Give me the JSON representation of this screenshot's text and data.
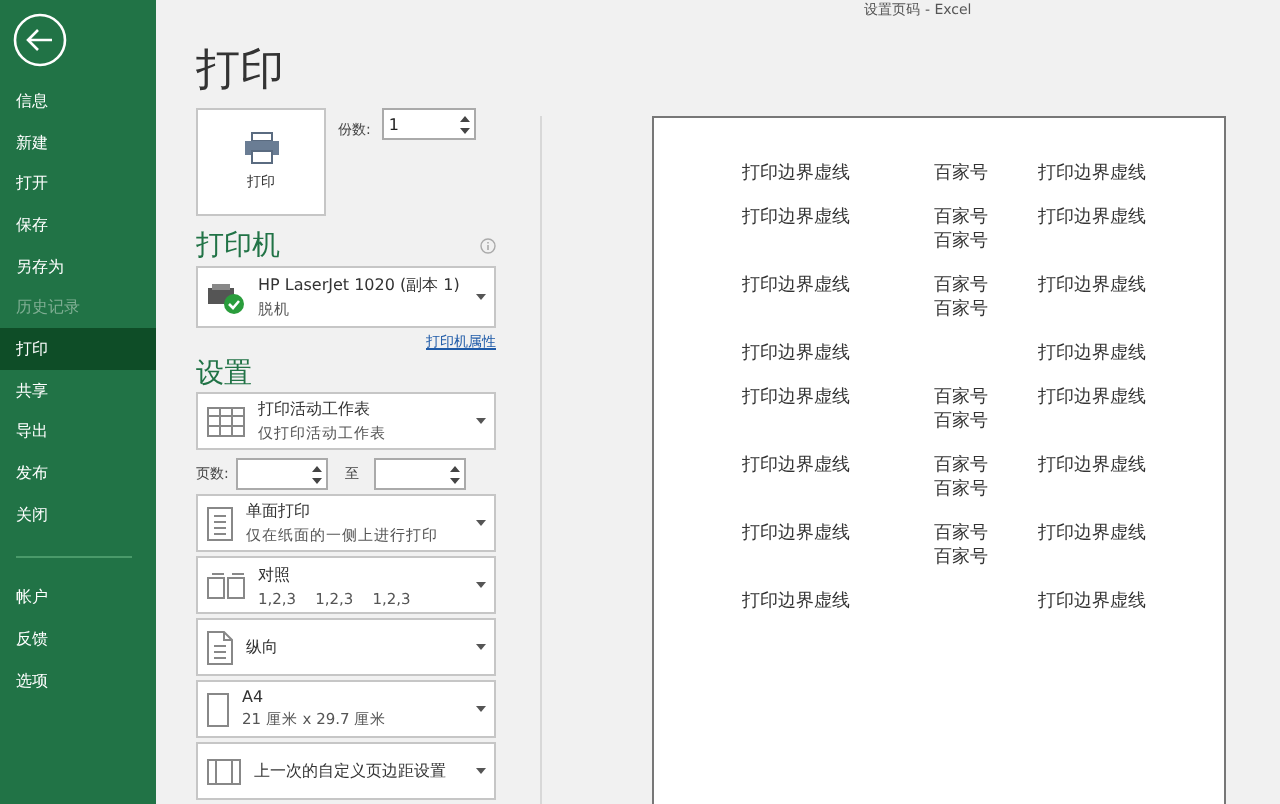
{
  "window": {
    "title": "设置页码 - Excel"
  },
  "sidebar": {
    "items": [
      {
        "label": "信息",
        "selected": false,
        "disabled": false
      },
      {
        "label": "新建",
        "selected": false,
        "disabled": false
      },
      {
        "label": "打开",
        "selected": false,
        "disabled": false
      },
      {
        "label": "保存",
        "selected": false,
        "disabled": false
      },
      {
        "label": "另存为",
        "selected": false,
        "disabled": false
      },
      {
        "label": "历史记录",
        "selected": false,
        "disabled": true
      },
      {
        "label": "打印",
        "selected": true,
        "disabled": false
      },
      {
        "label": "共享",
        "selected": false,
        "disabled": false
      },
      {
        "label": "导出",
        "selected": false,
        "disabled": false
      },
      {
        "label": "发布",
        "selected": false,
        "disabled": false
      },
      {
        "label": "关闭",
        "selected": false,
        "disabled": false
      }
    ],
    "bottom_items": [
      {
        "label": "帐户",
        "selected": false,
        "disabled": false
      },
      {
        "label": "反馈",
        "selected": false,
        "disabled": false
      },
      {
        "label": "选项",
        "selected": false,
        "disabled": false
      }
    ]
  },
  "page_title": "打印",
  "print_button": "打印",
  "copies": {
    "label": "份数:",
    "value": "1"
  },
  "printer": {
    "heading": "打印机",
    "name": "HP LaserJet 1020 (副本 1)",
    "status": "脱机",
    "properties_link": "打印机属性"
  },
  "settings": {
    "heading": "设置",
    "options_before_pages": [
      {
        "kind": "sheet",
        "title": "打印活动工作表",
        "subtitle": "仅打印活动工作表"
      }
    ],
    "pages": {
      "label": "页数:",
      "to": "至"
    },
    "options": [
      {
        "kind": "sides",
        "title": "单面打印",
        "subtitle": "仅在纸面的一侧上进行打印"
      },
      {
        "kind": "collate",
        "title": "对照",
        "subtitle": "1,2,3    1,2,3    1,2,3"
      },
      {
        "kind": "orientation",
        "title": "纵向"
      },
      {
        "kind": "paper",
        "title": "A4",
        "subtitle": "21 厘米 x 29.7 厘米"
      },
      {
        "kind": "margins",
        "title": "上一次的自定义页边距设置"
      }
    ]
  },
  "preview": {
    "rows": [
      {
        "left": "打印边界虚线",
        "middle": [
          "百家号"
        ],
        "right": "打印边界虚线"
      },
      {
        "left": "打印边界虚线",
        "middle": [
          "百家号",
          "百家号"
        ],
        "right": "打印边界虚线"
      },
      {
        "left": "打印边界虚线",
        "middle": [
          "百家号",
          "百家号"
        ],
        "right": "打印边界虚线"
      },
      {
        "left": "打印边界虚线",
        "middle": [],
        "right": "打印边界虚线"
      },
      {
        "left": "打印边界虚线",
        "middle": [
          "百家号",
          "百家号"
        ],
        "right": "打印边界虚线"
      },
      {
        "left": "打印边界虚线",
        "middle": [
          "百家号",
          "百家号"
        ],
        "right": "打印边界虚线"
      },
      {
        "left": "打印边界虚线",
        "middle": [
          "百家号",
          "百家号"
        ],
        "right": "打印边界虚线"
      },
      {
        "left": "打印边界虚线",
        "middle": [],
        "right": "打印边界虚线"
      }
    ]
  }
}
